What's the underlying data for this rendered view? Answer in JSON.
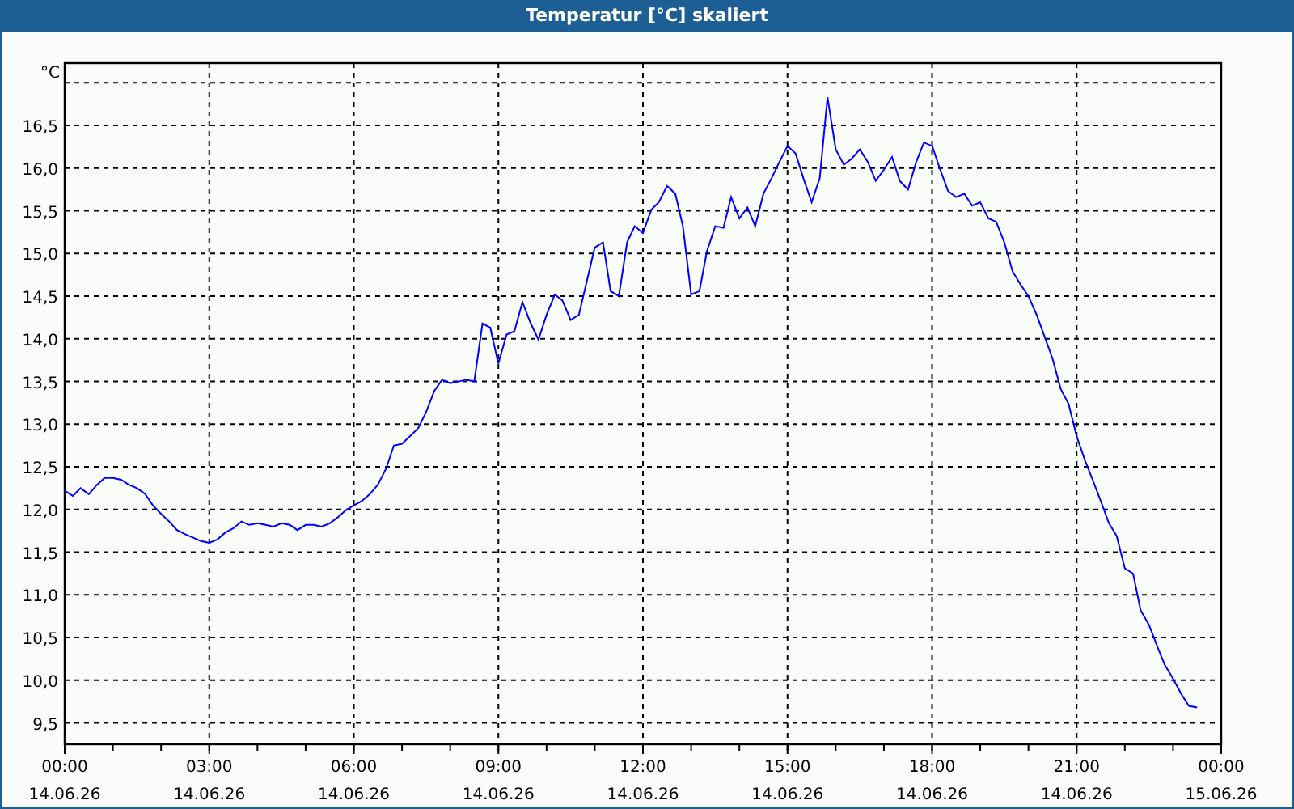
{
  "window": {
    "title": "Temperatur [°C] skaliert"
  },
  "chart": {
    "xtick_dates": [
      "14.06.26",
      "14.06.26",
      "14.06.26",
      "14.06.26",
      "14.06.26",
      "14.06.26",
      "14.06.26",
      "14.06.26",
      "15.06.26"
    ],
    "chart_data": {
      "type": "line",
      "ylabel": "°C",
      "grid": true,
      "xlim": [
        0,
        24
      ],
      "ylim": [
        9.25,
        17.23
      ],
      "xticks": [
        {
          "value": 0,
          "label": "00:00"
        },
        {
          "value": 3,
          "label": "03:00"
        },
        {
          "value": 6,
          "label": "06:00"
        },
        {
          "value": 9,
          "label": "09:00"
        },
        {
          "value": 12,
          "label": "12:00"
        },
        {
          "value": 15,
          "label": "15:00"
        },
        {
          "value": 18,
          "label": "18:00"
        },
        {
          "value": 21,
          "label": "21:00"
        },
        {
          "value": 24,
          "label": "00:00"
        }
      ],
      "yticks": [
        {
          "value": 9.5,
          "label": "9,5"
        },
        {
          "value": 10,
          "label": "10,0"
        },
        {
          "value": 10.5,
          "label": "10,5"
        },
        {
          "value": 11,
          "label": "11,0"
        },
        {
          "value": 11.5,
          "label": "11,5"
        },
        {
          "value": 12,
          "label": "12,0"
        },
        {
          "value": 12.5,
          "label": "12,5"
        },
        {
          "value": 13,
          "label": "13,0"
        },
        {
          "value": 13.5,
          "label": "13,5"
        },
        {
          "value": 14,
          "label": "14,0"
        },
        {
          "value": 14.5,
          "label": "14,5"
        },
        {
          "value": 15,
          "label": "15,0"
        },
        {
          "value": 15.5,
          "label": "15,5"
        },
        {
          "value": 16,
          "label": "16,0"
        },
        {
          "value": 16.5,
          "label": "16,5"
        }
      ],
      "x": [
        0,
        0.17,
        0.33,
        0.5,
        0.67,
        0.83,
        1,
        1.17,
        1.33,
        1.5,
        1.67,
        1.83,
        2,
        2.17,
        2.33,
        2.5,
        2.67,
        2.83,
        3,
        3.17,
        3.33,
        3.5,
        3.67,
        3.83,
        4,
        4.17,
        4.33,
        4.5,
        4.67,
        4.83,
        5,
        5.17,
        5.33,
        5.5,
        5.67,
        5.83,
        6,
        6.17,
        6.33,
        6.5,
        6.67,
        6.83,
        7,
        7.17,
        7.33,
        7.5,
        7.67,
        7.83,
        8,
        8.17,
        8.33,
        8.5,
        8.67,
        8.83,
        9,
        9.17,
        9.33,
        9.5,
        9.67,
        9.83,
        10,
        10.17,
        10.33,
        10.5,
        10.67,
        10.83,
        11,
        11.17,
        11.33,
        11.5,
        11.67,
        11.83,
        12,
        12.17,
        12.33,
        12.5,
        12.67,
        12.83,
        13,
        13.17,
        13.33,
        13.5,
        13.67,
        13.83,
        14,
        14.17,
        14.33,
        14.5,
        14.67,
        14.83,
        15,
        15.17,
        15.33,
        15.5,
        15.67,
        15.83,
        16,
        16.17,
        16.33,
        16.5,
        16.67,
        16.83,
        17,
        17.17,
        17.33,
        17.5,
        17.67,
        17.83,
        18,
        18.17,
        18.33,
        18.5,
        18.67,
        18.83,
        19,
        19.17,
        19.33,
        19.5,
        19.67,
        19.83,
        20,
        20.17,
        20.33,
        20.5,
        20.67,
        20.83,
        21,
        21.17,
        21.33,
        21.5,
        21.67,
        21.83,
        22,
        22.17,
        22.33,
        22.5,
        22.67,
        22.83,
        23,
        23.17,
        23.33,
        23.5
      ],
      "series": [
        {
          "color": "#0000ff",
          "values": [
            12.22,
            12.16,
            12.25,
            12.18,
            12.29,
            12.37,
            12.37,
            12.35,
            12.29,
            12.25,
            12.18,
            12.05,
            11.95,
            11.86,
            11.76,
            11.71,
            11.67,
            11.63,
            11.61,
            11.65,
            11.73,
            11.78,
            11.86,
            11.82,
            11.84,
            11.82,
            11.8,
            11.84,
            11.82,
            11.76,
            11.82,
            11.82,
            11.8,
            11.84,
            11.91,
            11.99,
            12.05,
            12.1,
            12.18,
            12.29,
            12.48,
            12.75,
            12.77,
            12.86,
            12.95,
            13.14,
            13.39,
            13.52,
            13.48,
            13.5,
            13.52,
            13.5,
            14.18,
            14.13,
            13.71,
            14.05,
            14.09,
            14.43,
            14.18,
            13.99,
            14.28,
            14.52,
            14.45,
            14.22,
            14.28,
            14.66,
            15.07,
            15.13,
            14.56,
            14.5,
            15.13,
            15.32,
            15.24,
            15.51,
            15.6,
            15.79,
            15.7,
            15.32,
            14.52,
            14.56,
            15.03,
            15.32,
            15.3,
            15.66,
            15.41,
            15.54,
            15.32,
            15.7,
            15.88,
            16.07,
            16.26,
            16.17,
            15.88,
            15.6,
            15.88,
            16.83,
            16.22,
            16.04,
            16.11,
            16.22,
            16.07,
            15.85,
            15.98,
            16.13,
            15.85,
            15.75,
            16.07,
            16.3,
            16.26,
            15.98,
            15.73,
            15.66,
            15.7,
            15.56,
            15.6,
            15.41,
            15.37,
            15.13,
            14.79,
            14.64,
            14.5,
            14.28,
            14.03,
            13.77,
            13.41,
            13.24,
            12.86,
            12.58,
            12.35,
            12.1,
            11.84,
            11.69,
            11.31,
            11.25,
            10.82,
            10.65,
            10.4,
            10.18,
            10.02,
            9.84,
            9.7,
            9.68
          ]
        }
      ]
    }
  }
}
